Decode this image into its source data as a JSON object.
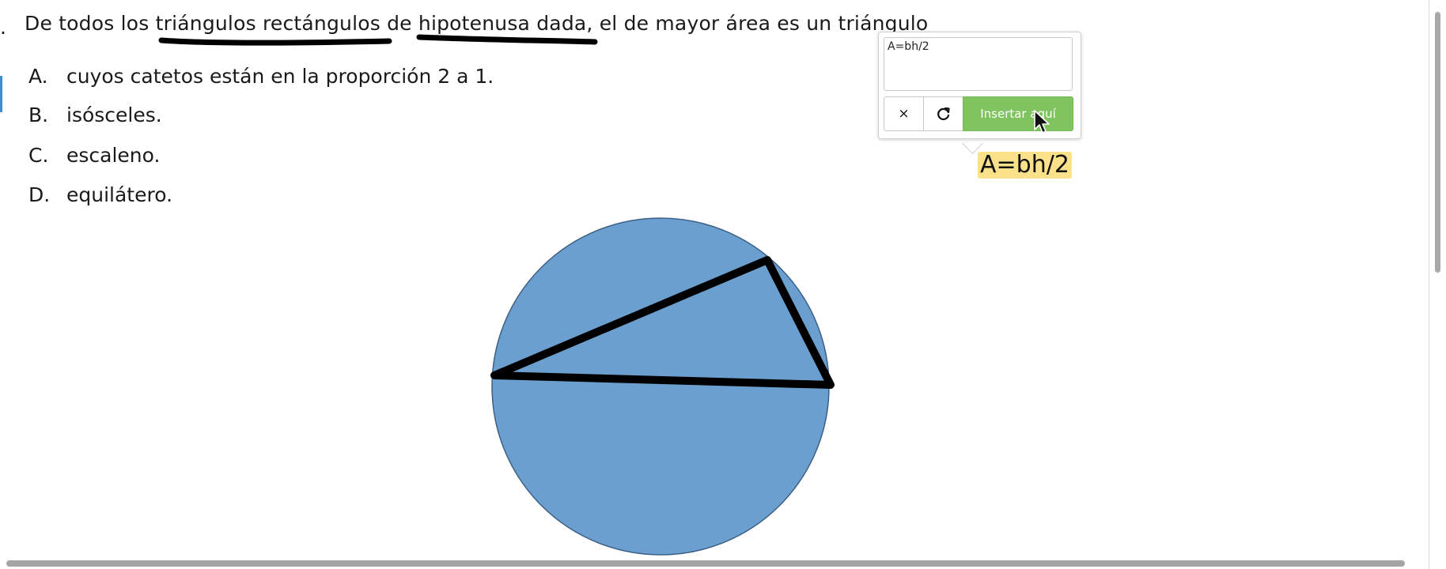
{
  "question": {
    "stem_before": "De todos los ",
    "underline_1": "triángulos rectángulos",
    "stem_middle": " de ",
    "underline_2": "hipotenusa dada",
    "stem_after": ", el de mayor área es un triángulo"
  },
  "options": [
    {
      "letter": "A.",
      "text": "cuyos catetos están en la proporción 2 a 1."
    },
    {
      "letter": "B.",
      "text": "isósceles."
    },
    {
      "letter": "C.",
      "text": "escaleno."
    },
    {
      "letter": "D.",
      "text": "equilátero."
    }
  ],
  "formula_popup": {
    "input_value": "A=bh/2",
    "close_label": "×",
    "refresh_icon": "refresh-icon",
    "insert_label": "Insertar aquí",
    "insert_color": "#80c460"
  },
  "rendered_formula": "A=bh/2",
  "figure": {
    "circle_fill": "#6b9fcf",
    "circle_stroke": "#3d5f85",
    "triangle_stroke": "#000000"
  }
}
